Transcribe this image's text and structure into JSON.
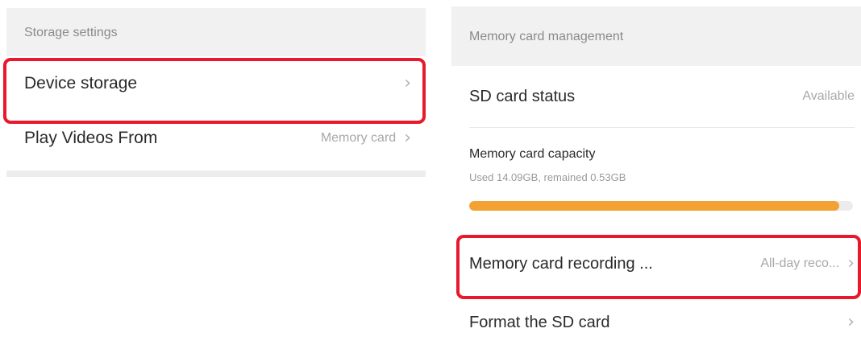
{
  "left": {
    "section_title": "Storage settings",
    "items": [
      {
        "label": "Device storage",
        "value": ""
      },
      {
        "label": "Play Videos From",
        "value": "Memory card"
      }
    ]
  },
  "right": {
    "section_title": "Memory card management",
    "sd_status": {
      "label": "SD card status",
      "value": "Available"
    },
    "capacity": {
      "title": "Memory card capacity",
      "detail": "Used 14.09GB, remained 0.53GB",
      "used_fraction": 0.964
    },
    "recording": {
      "label": "Memory card recording ...",
      "value": "All-day reco..."
    },
    "format": {
      "label": "Format the SD card"
    }
  },
  "colors": {
    "highlight": "#e8192c",
    "progress_fill": "#f4a133",
    "section_bg": "#f1f1f1"
  },
  "icons": {
    "chevron": "›"
  }
}
